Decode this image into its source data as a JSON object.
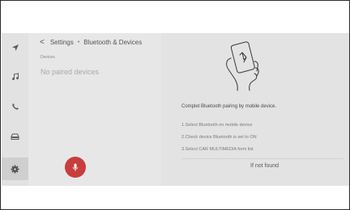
{
  "header": {
    "back_glyph": "<",
    "title": "Settings",
    "separator": "•",
    "subtitle": "Bluetooth & Devices"
  },
  "devices": {
    "section_label": "Devices",
    "empty_message": "No paired devices"
  },
  "rail": {
    "icons": [
      "navigation-icon",
      "music-icon",
      "phone-icon",
      "car-icon",
      "settings-gear-icon"
    ],
    "active": "settings-gear-icon"
  },
  "voice": {
    "icon": "microphone-icon",
    "color": "#c83d3d"
  },
  "pairing": {
    "illustration": "phone-in-hand-bluetooth-icon",
    "prompt": "Complet Bluetooth pairing by mobile device.",
    "steps": [
      "1.Select Bluetooth on mobile device",
      "2.Check device Bluetooth is set to ON",
      "3.Select CAR MULTIMEDIA form list"
    ],
    "not_found_label": "If not found"
  }
}
